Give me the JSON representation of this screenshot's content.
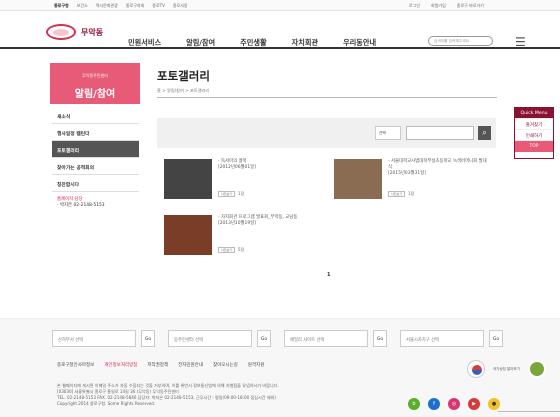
{
  "top": {
    "util": [
      "종로구청",
      "보건소",
      "역사문화관광",
      "종로구의회",
      "종로TV",
      "종로사랑"
    ],
    "right": [
      "로그인",
      "회원가입",
      "종로구 바로가기"
    ]
  },
  "header": {
    "brand": "무악동",
    "nav": [
      "민원서비스",
      "알림/참여",
      "주민생활",
      "자치회관",
      "우리동안내"
    ],
    "search_placeholder": "검색어를 입력해주세요"
  },
  "sidebar": {
    "subtitle": "무악동주민센터",
    "title": "알림/참여",
    "items": [
      "새소식",
      "행사일정 캘린더",
      "포토갤러리",
      "찾아가는 공적회의",
      "칭찬합시다"
    ],
    "notice_title": "홈페이지 담당",
    "notice_text": "- 박지은 02-2148-5153"
  },
  "main": {
    "page_title": "포토갤러리",
    "breadcrumb": "홈 > 알림/참여 > 포토갤러리",
    "select": "선택",
    "page_number": "1"
  },
  "gallery": [
    {
      "title": "- 독서미의 끓복",
      "date": "[2012년06월01일]",
      "views": "1장"
    },
    {
      "title": "- 서울대학교사범대학부설초등학교 녹색어머니회 발대식",
      "date": "[2015년03월31일]",
      "views": "1장"
    },
    {
      "title": "- 자치회관 프로그램 발표회_무악동, 교남동",
      "date": "[2013년10월19일]",
      "views": "5장"
    }
  ],
  "quick": {
    "title": "Quick Menu",
    "items": [
      "즐겨찾기",
      "인쇄하기",
      "TOP"
    ]
  },
  "footer": {
    "selects": [
      "산하부서 선택",
      "동주민센터 선택",
      "패밀리 사이트 선택",
      "서울시자치구 선택"
    ],
    "go": "Go",
    "links": [
      "종로구청인사마정보",
      "개인정보처리방침",
      "저작권정책",
      "전자민원안내",
      "찾아오시는길",
      "원격지원"
    ],
    "address": "[03030] 서울특별시 종로구 통일로 14길 36 (무악동) 무악동주민센터",
    "contact": "TEL. 02-2148-5153  FAX. 02-2148-5846  담당자: 박지은 02-2148-5153, 근무시간 : 평일(09:00-18:00 점심시간 제외)",
    "copyright": "Copyright 2014 종로구청. Some Rights Reserved.",
    "notice": "본 웹페이지에 게시된 이메일 주소가 자동 수집되는 것을 거부하며, 이를 위반시 정보통신법에 의해 처벌됨을 유념하시기 바랍니다.",
    "badge": "국가상징\n알아보기"
  }
}
